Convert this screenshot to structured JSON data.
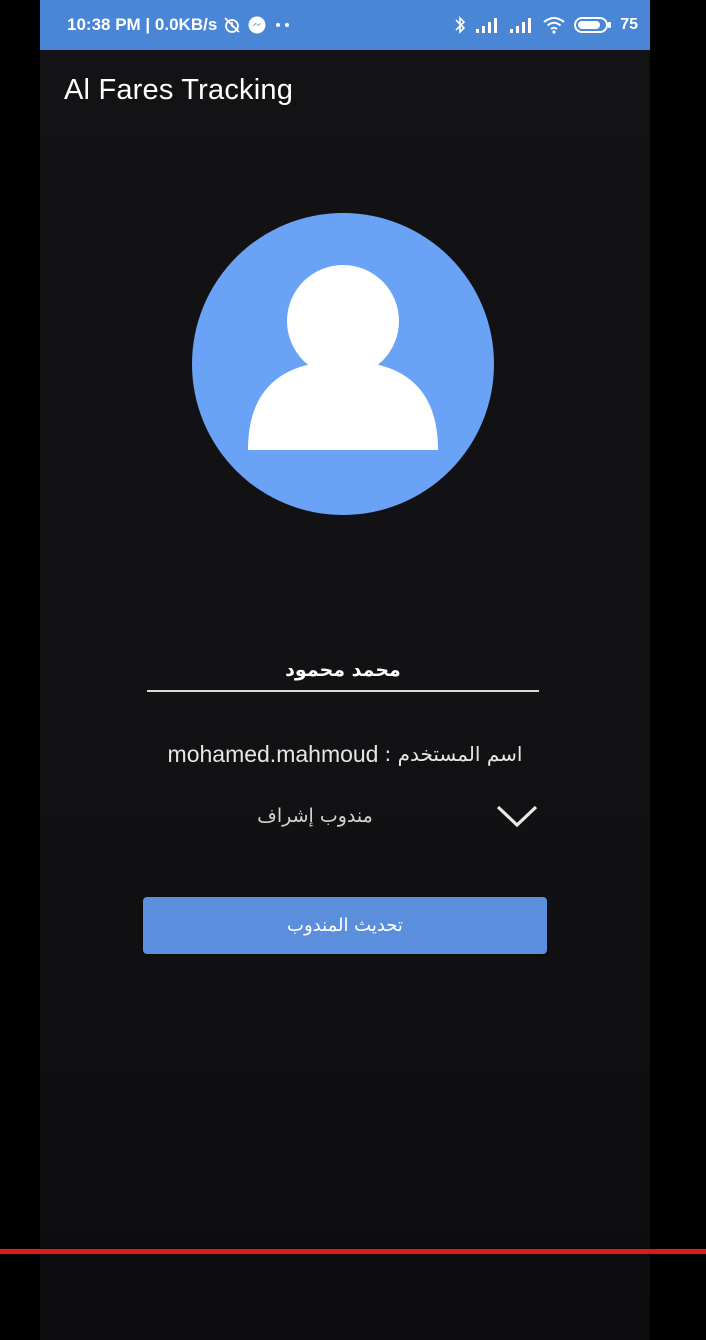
{
  "status_bar": {
    "time_and_speed": "10:38 PM | 0.0KB/s",
    "battery_level": "75",
    "icons": [
      "alarm-off-icon",
      "messenger-icon",
      "more-dots-icon",
      "bluetooth-icon",
      "signal-icon",
      "signal-icon",
      "wifi-icon",
      "battery-icon"
    ]
  },
  "app_bar": {
    "title": "Al Fares Tracking"
  },
  "profile": {
    "avatar_icon": "person-icon",
    "avatar_color": "#6aa3f5",
    "name_value": "محمد محمود",
    "username_label": "اسم المستخدم :",
    "username_value": "mohamed.mahmoud",
    "role_value": "مندوب إشراف",
    "role_dropdown_icon": "chevron-down-icon"
  },
  "actions": {
    "update_button_label": "تحديث المندوب"
  },
  "colors": {
    "accent": "#5b8fde",
    "status_bar": "#4a86d6",
    "background": "#121214",
    "progress_line": "#e01818"
  }
}
